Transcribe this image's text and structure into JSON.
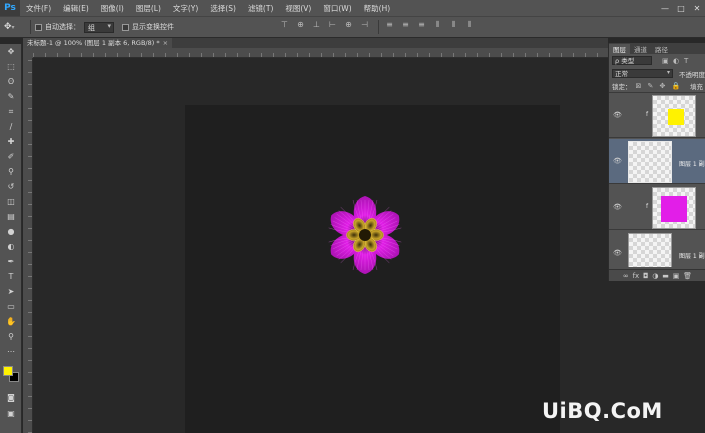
{
  "app": {
    "logo": "Ps"
  },
  "menu": [
    "文件(F)",
    "编辑(E)",
    "图像(I)",
    "图层(L)",
    "文字(Y)",
    "选择(S)",
    "滤镜(T)",
    "视图(V)",
    "窗口(W)",
    "帮助(H)"
  ],
  "window_controls": [
    "—",
    "□",
    "✕"
  ],
  "options": {
    "auto_select_label": "自动选择：",
    "auto_select_value": "组",
    "show_transform_label": "显示变换控件"
  },
  "document": {
    "tab_title": "未标题-1 @ 100% (图层 1 副本 6, RGB/8) *",
    "tab_close": "×"
  },
  "tools": [
    {
      "name": "move-tool",
      "glyph": "✥"
    },
    {
      "name": "marquee-tool",
      "glyph": "⬚"
    },
    {
      "name": "lasso-tool",
      "glyph": "ʘ"
    },
    {
      "name": "quick-select-tool",
      "glyph": "✎"
    },
    {
      "name": "crop-tool",
      "glyph": "⌗"
    },
    {
      "name": "eyedropper-tool",
      "glyph": "∕"
    },
    {
      "name": "healing-brush-tool",
      "glyph": "✚"
    },
    {
      "name": "brush-tool",
      "glyph": "✐"
    },
    {
      "name": "clone-stamp-tool",
      "glyph": "⚲"
    },
    {
      "name": "history-brush-tool",
      "glyph": "↺"
    },
    {
      "name": "eraser-tool",
      "glyph": "◫"
    },
    {
      "name": "gradient-tool",
      "glyph": "▤"
    },
    {
      "name": "blur-tool",
      "glyph": "●"
    },
    {
      "name": "dodge-tool",
      "glyph": "◐"
    },
    {
      "name": "pen-tool",
      "glyph": "✒"
    },
    {
      "name": "type-tool",
      "glyph": "T"
    },
    {
      "name": "path-select-tool",
      "glyph": "➤"
    },
    {
      "name": "rectangle-tool",
      "glyph": "▭"
    },
    {
      "name": "hand-tool",
      "glyph": "✋"
    },
    {
      "name": "zoom-tool",
      "glyph": "⚲"
    },
    {
      "name": "edit-toolbar",
      "glyph": "⋯"
    }
  ],
  "colors": {
    "foreground": "#fff200",
    "background": "#000000",
    "petal": "#e21ee8",
    "center": "#c9a52a"
  },
  "layers_panel": {
    "tabs": [
      "图层",
      "通道",
      "路径"
    ],
    "filter_kind": "ρ 类型",
    "blend_mode": "正常",
    "opacity_label": "不透明度",
    "lock_label": "锁定：",
    "fill_label": "填充",
    "layers": [
      {
        "name": "",
        "thumb_color": "#fff200",
        "has_link": true,
        "selected": false
      },
      {
        "name": "图层 1 副本",
        "thumb_color": "",
        "has_link": false,
        "selected": true
      },
      {
        "name": "",
        "thumb_color": "#e21ee8",
        "has_link": true,
        "selected": false
      },
      {
        "name": "图层 1 副",
        "thumb_color": "",
        "has_link": false,
        "selected": false
      }
    ],
    "bottom_icons": [
      "∞",
      "fx",
      "◘",
      "◑",
      "▬",
      "▣",
      "🗑"
    ]
  },
  "watermark": "UiBQ.CoM"
}
